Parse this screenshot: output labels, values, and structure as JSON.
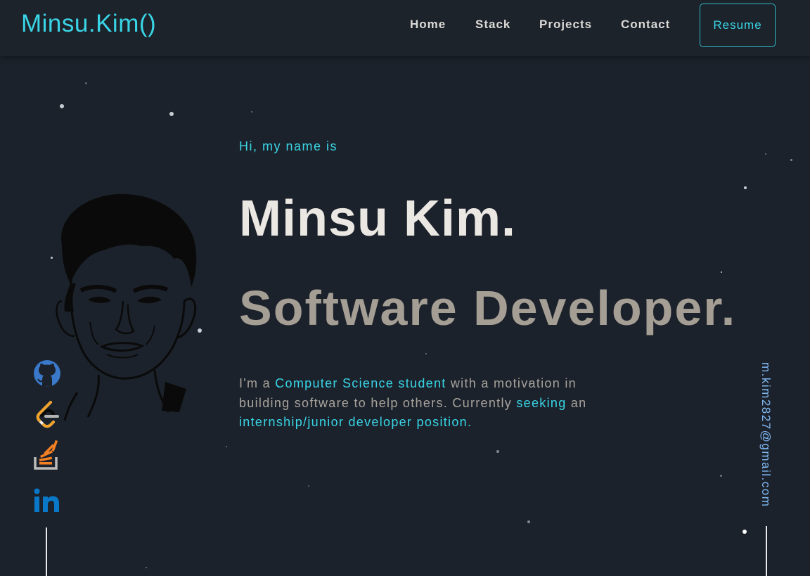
{
  "header": {
    "logo": "Minsu.Kim()",
    "nav": [
      "Home",
      "Stack",
      "Projects",
      "Contact"
    ],
    "resume_label": "Resume"
  },
  "hero": {
    "greeting": "Hi, my name is",
    "name": "Minsu Kim.",
    "role": "Software Developer.",
    "bio": {
      "p1": "I'm a ",
      "h1": "Computer Science student",
      "p2": " with a motivation in building software to help others. Currently ",
      "h2": "seeking",
      "p3": " an ",
      "h3": "internship/junior developer position."
    }
  },
  "socials": [
    {
      "icon": "github-icon"
    },
    {
      "icon": "leetcode-icon"
    },
    {
      "icon": "stackoverflow-icon"
    },
    {
      "icon": "linkedin-icon"
    }
  ],
  "email": "m.kim2827@gmail.com",
  "colors": {
    "background": "#1c222b",
    "accent": "#39d5e6",
    "name": "#ebe7e3",
    "role": "#a59e94",
    "email": "#7fb9f5"
  }
}
